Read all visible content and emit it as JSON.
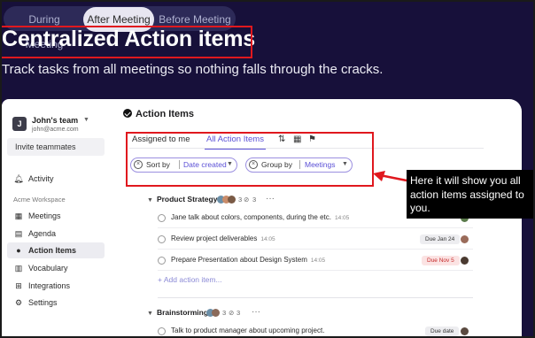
{
  "segments": [
    "During Meeting",
    "After Meeting",
    "Before Meeting"
  ],
  "active_segment": 1,
  "headline": "Centralized Action items",
  "subheadline": "Track tasks from all meetings so nothing falls through the cracks.",
  "sidebar": {
    "team_initial": "J",
    "team_name": "John's team",
    "team_email": "john@acme.com",
    "invite_label": "Invite teammates",
    "activity_label": "Activity",
    "section_label": "Acme Workspace",
    "items": [
      {
        "label": "Meetings",
        "icon": "calendar-icon"
      },
      {
        "label": "Agenda",
        "icon": "document-icon"
      },
      {
        "label": "Action Items",
        "icon": "check-circle-icon"
      },
      {
        "label": "Vocabulary",
        "icon": "book-icon"
      },
      {
        "label": "Integrations",
        "icon": "puzzle-icon"
      },
      {
        "label": "Settings",
        "icon": "gear-icon"
      }
    ]
  },
  "main": {
    "title": "Action Items",
    "tabs": [
      "Assigned to me",
      "All Action Items"
    ],
    "active_tab": 1,
    "filters": [
      {
        "key": "Sort by",
        "value": "Date created"
      },
      {
        "key": "Group by",
        "value": "Meetings"
      }
    ],
    "groups": [
      {
        "name": "Product Strategy",
        "count": "3",
        "tasks": [
          {
            "text": "Jane talk about colors, components, during the etc.",
            "time": "14:05",
            "badge": ""
          },
          {
            "text": "Review project deliverables",
            "time": "14:05",
            "badge": "Due Jan 24"
          },
          {
            "text": "Prepare Presentation about Design System",
            "time": "14:05",
            "badge": "Due Nov 5"
          }
        ],
        "add_label": "Add action item..."
      },
      {
        "name": "Brainstorming",
        "count": "3",
        "tasks": [
          {
            "text": "Talk to product manager about upcoming project.",
            "time": "",
            "badge": "Due date"
          }
        ]
      }
    ],
    "ellipsis": "···"
  },
  "callout": "Here it will show you all action items assigned to you.",
  "colors": {
    "accent": "#5b50d6",
    "highlight": "#e0181e",
    "background": "#17103a"
  }
}
